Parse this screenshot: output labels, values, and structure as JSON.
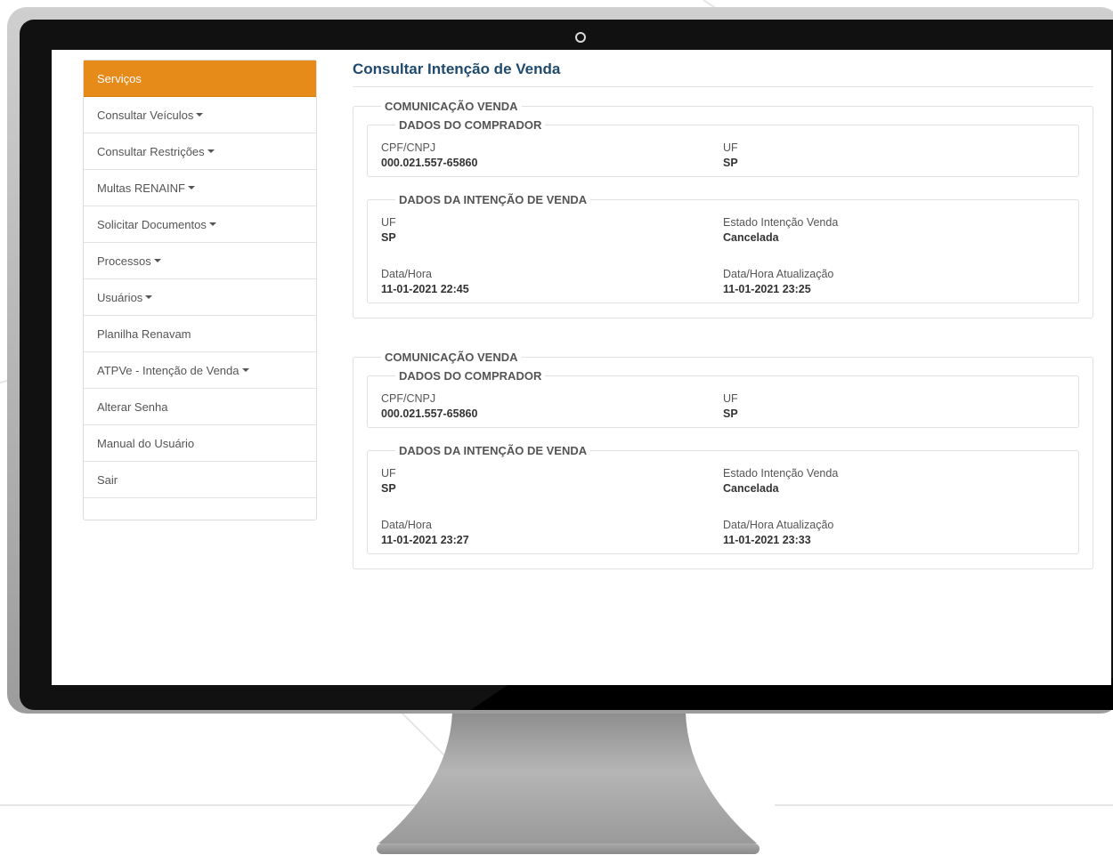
{
  "sidebar": {
    "items": [
      {
        "label": "Serviços",
        "active": true,
        "dropdown": false
      },
      {
        "label": "Consultar Veículos",
        "dropdown": true
      },
      {
        "label": "Consultar Restrições",
        "dropdown": true
      },
      {
        "label": "Multas RENAINF",
        "dropdown": true
      },
      {
        "label": "Solicitar Documentos",
        "dropdown": true
      },
      {
        "label": "Processos",
        "dropdown": true
      },
      {
        "label": "Usuários",
        "dropdown": true
      },
      {
        "label": "Planilha Renavam",
        "dropdown": false
      },
      {
        "label": "ATPVe - Intenção de Venda",
        "dropdown": true
      },
      {
        "label": "Alterar Senha",
        "dropdown": false
      },
      {
        "label": "Manual do Usuário",
        "dropdown": false
      },
      {
        "label": "Sair",
        "dropdown": false
      }
    ]
  },
  "main": {
    "title": "Consultar Intenção de Venda",
    "records": [
      {
        "legend": "COMUNICAÇÃO VENDA",
        "buyer": {
          "legend": "DADOS DO COMPRADOR",
          "cpf_label": "CPF/CNPJ",
          "cpf_value": "000.021.557-65860",
          "uf_label": "UF",
          "uf_value": "SP"
        },
        "intent": {
          "legend": "DADOS DA INTENÇÃO DE VENDA",
          "uf_label": "UF",
          "uf_value": "SP",
          "state_label": "Estado Intenção Venda",
          "state_value": "Cancelada",
          "datetime_label": "Data/Hora",
          "datetime_value": "11-01-2021 22:45",
          "updated_label": "Data/Hora Atualização",
          "updated_value": "11-01-2021 23:25"
        }
      },
      {
        "legend": "COMUNICAÇÃO VENDA",
        "buyer": {
          "legend": "DADOS DO COMPRADOR",
          "cpf_label": "CPF/CNPJ",
          "cpf_value": "000.021.557-65860",
          "uf_label": "UF",
          "uf_value": "SP"
        },
        "intent": {
          "legend": "DADOS DA INTENÇÃO DE VENDA",
          "uf_label": "UF",
          "uf_value": "SP",
          "state_label": "Estado Intenção Venda",
          "state_value": "Cancelada",
          "datetime_label": "Data/Hora",
          "datetime_value": "11-01-2021 23:27",
          "updated_label": "Data/Hora Atualização",
          "updated_value": "11-01-2021 23:33"
        }
      }
    ]
  },
  "colors": {
    "accent": "#e68a1a",
    "title": "#1f4a6e",
    "bezel": "#111111"
  }
}
